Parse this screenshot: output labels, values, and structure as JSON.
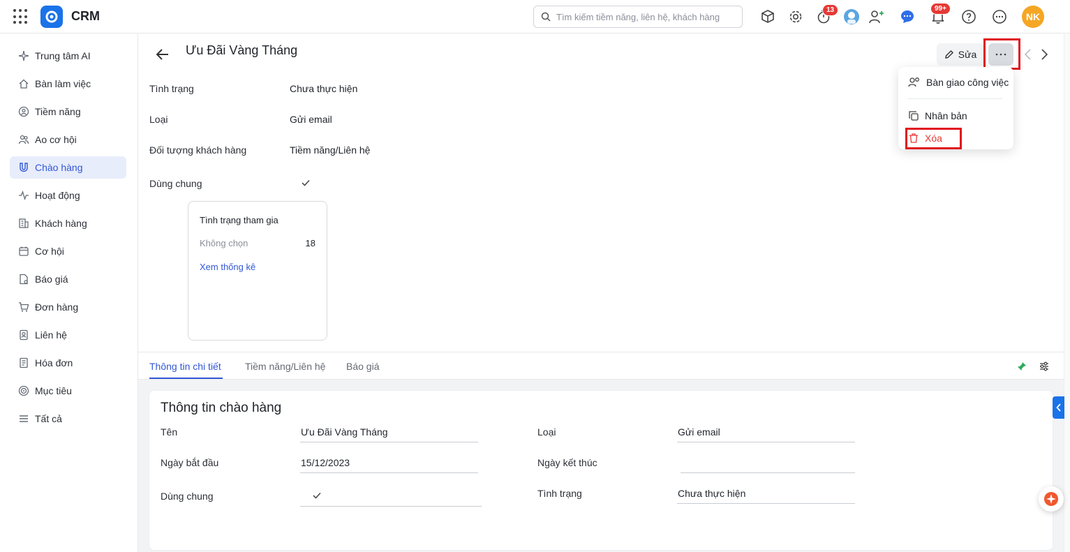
{
  "app": {
    "name": "CRM"
  },
  "search": {
    "placeholder": "Tìm kiếm tiềm năng, liên hệ, khách hàng"
  },
  "topbar": {
    "timer_badge": "13",
    "notification_badge": "99+",
    "user_initials": "NK"
  },
  "sidebar": {
    "items": [
      {
        "label": "Trung tâm AI",
        "icon": "sparkle-icon"
      },
      {
        "label": "Bàn làm việc",
        "icon": "home-icon"
      },
      {
        "label": "Tiềm năng",
        "icon": "prospect-icon"
      },
      {
        "label": "Ao cơ hội",
        "icon": "users-icon"
      },
      {
        "label": "Chào hàng",
        "icon": "magnet-icon",
        "active": true
      },
      {
        "label": "Hoạt động",
        "icon": "activity-icon"
      },
      {
        "label": "Khách hàng",
        "icon": "building-icon"
      },
      {
        "label": "Cơ hội",
        "icon": "calendar-icon"
      },
      {
        "label": "Báo giá",
        "icon": "document-icon"
      },
      {
        "label": "Đơn hàng",
        "icon": "cart-icon"
      },
      {
        "label": "Liên hệ",
        "icon": "contact-icon"
      },
      {
        "label": "Hóa đơn",
        "icon": "invoice-icon"
      },
      {
        "label": "Mục tiêu",
        "icon": "target-icon"
      },
      {
        "label": "Tất cả",
        "icon": "menu-icon"
      }
    ]
  },
  "record": {
    "title": "Ưu Đãi Vàng Tháng",
    "edit_label": "Sửa",
    "fields": [
      {
        "label": "Tình trạng",
        "value": "Chưa thực hiện"
      },
      {
        "label": "Loại",
        "value": "Gửi email"
      },
      {
        "label": "Đối tượng khách hàng",
        "value": "Tiềm năng/Liên hệ"
      },
      {
        "label": "Dùng chung",
        "value": ""
      }
    ]
  },
  "stat_card": {
    "title": "Tình trạng tham gia",
    "row_label": "Không chọn",
    "row_value": "18",
    "link": "Xem thống kê"
  },
  "dropdown": {
    "items": [
      {
        "label": "Bàn giao công việc",
        "icon": "handover-icon"
      },
      {
        "label": "Nhân bản",
        "icon": "copy-icon"
      },
      {
        "label": "Xóa",
        "icon": "trash-icon",
        "color": "#e53935"
      }
    ]
  },
  "tabs": [
    {
      "label": "Thông tin chi tiết",
      "active": true
    },
    {
      "label": "Tiềm năng/Liên hệ"
    },
    {
      "label": "Báo giá"
    }
  ],
  "detail": {
    "section_title": "Thông tin chào hàng",
    "left": [
      {
        "label": "Tên",
        "value": "Ưu Đãi Vàng Tháng"
      },
      {
        "label": "Ngày bắt đầu",
        "value": "15/12/2023"
      },
      {
        "label": "Dùng chung",
        "value": ""
      }
    ],
    "right": [
      {
        "label": "Loại",
        "value": "Gửi email"
      },
      {
        "label": "Ngày kết thúc",
        "value": ""
      },
      {
        "label": "Tình trạng",
        "value": "Chưa thực hiện"
      }
    ]
  },
  "colors": {
    "accent": "#3157d6",
    "danger": "#e53935",
    "highlight_box": "#e0141e",
    "avatar": "#f5a623"
  }
}
